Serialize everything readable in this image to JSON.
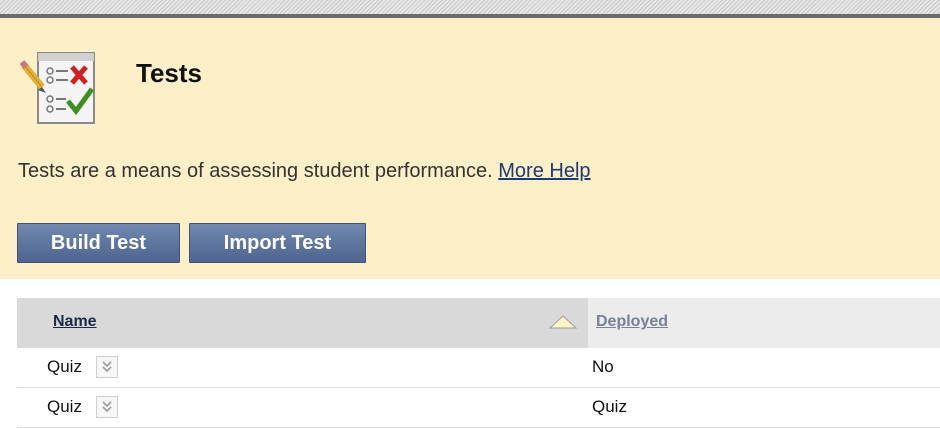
{
  "header": {
    "title": "Tests",
    "description": "Tests are a means of assessing student performance.",
    "help_link": "More Help",
    "icon": "tests-checklist-icon"
  },
  "toolbar": {
    "build_label": "Build Test",
    "import_label": "Import Test"
  },
  "table": {
    "columns": [
      "Name",
      "Deployed"
    ],
    "sort": "ascending",
    "rows": [
      {
        "name": "Quiz",
        "deployed": "No"
      },
      {
        "name": "Quiz",
        "deployed": "Quiz"
      }
    ]
  },
  "colors": {
    "panel_bg": "#fdf0c8",
    "button_bg": "#5d7499",
    "link": "#1e3a76"
  }
}
